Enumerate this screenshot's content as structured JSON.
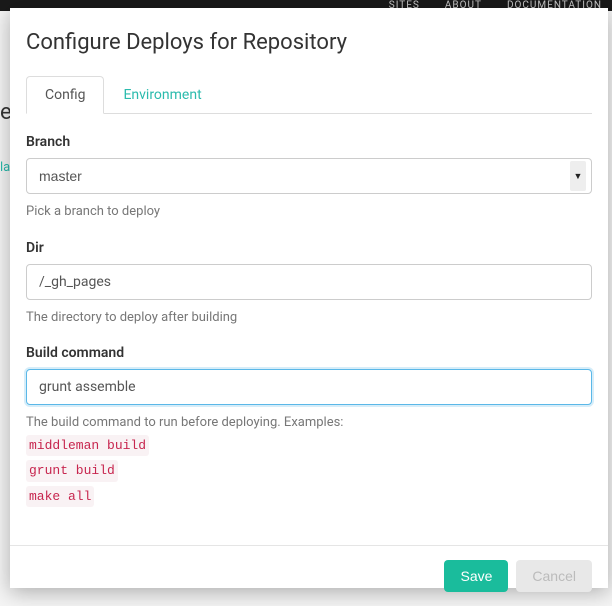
{
  "background": {
    "nav": {
      "sites": "SITES",
      "about": "ABOUT",
      "docs": "DOCUMENTATION"
    },
    "hint_left": "e",
    "hint_left2": "la"
  },
  "modal": {
    "title": "Configure Deploys for Repository",
    "tabs": {
      "config": "Config",
      "environment": "Environment"
    },
    "branch": {
      "label": "Branch",
      "value": "master",
      "help": "Pick a branch to deploy"
    },
    "dir": {
      "label": "Dir",
      "value": "/_gh_pages",
      "help": "The directory to deploy after building"
    },
    "build": {
      "label": "Build command",
      "value": "grunt assemble",
      "help": "The build command to run before deploying. Examples:",
      "examples": {
        "ex1": "middleman build",
        "ex2": "grunt build",
        "ex3": "make all"
      }
    },
    "footer": {
      "save": "Save",
      "cancel": "Cancel"
    }
  }
}
